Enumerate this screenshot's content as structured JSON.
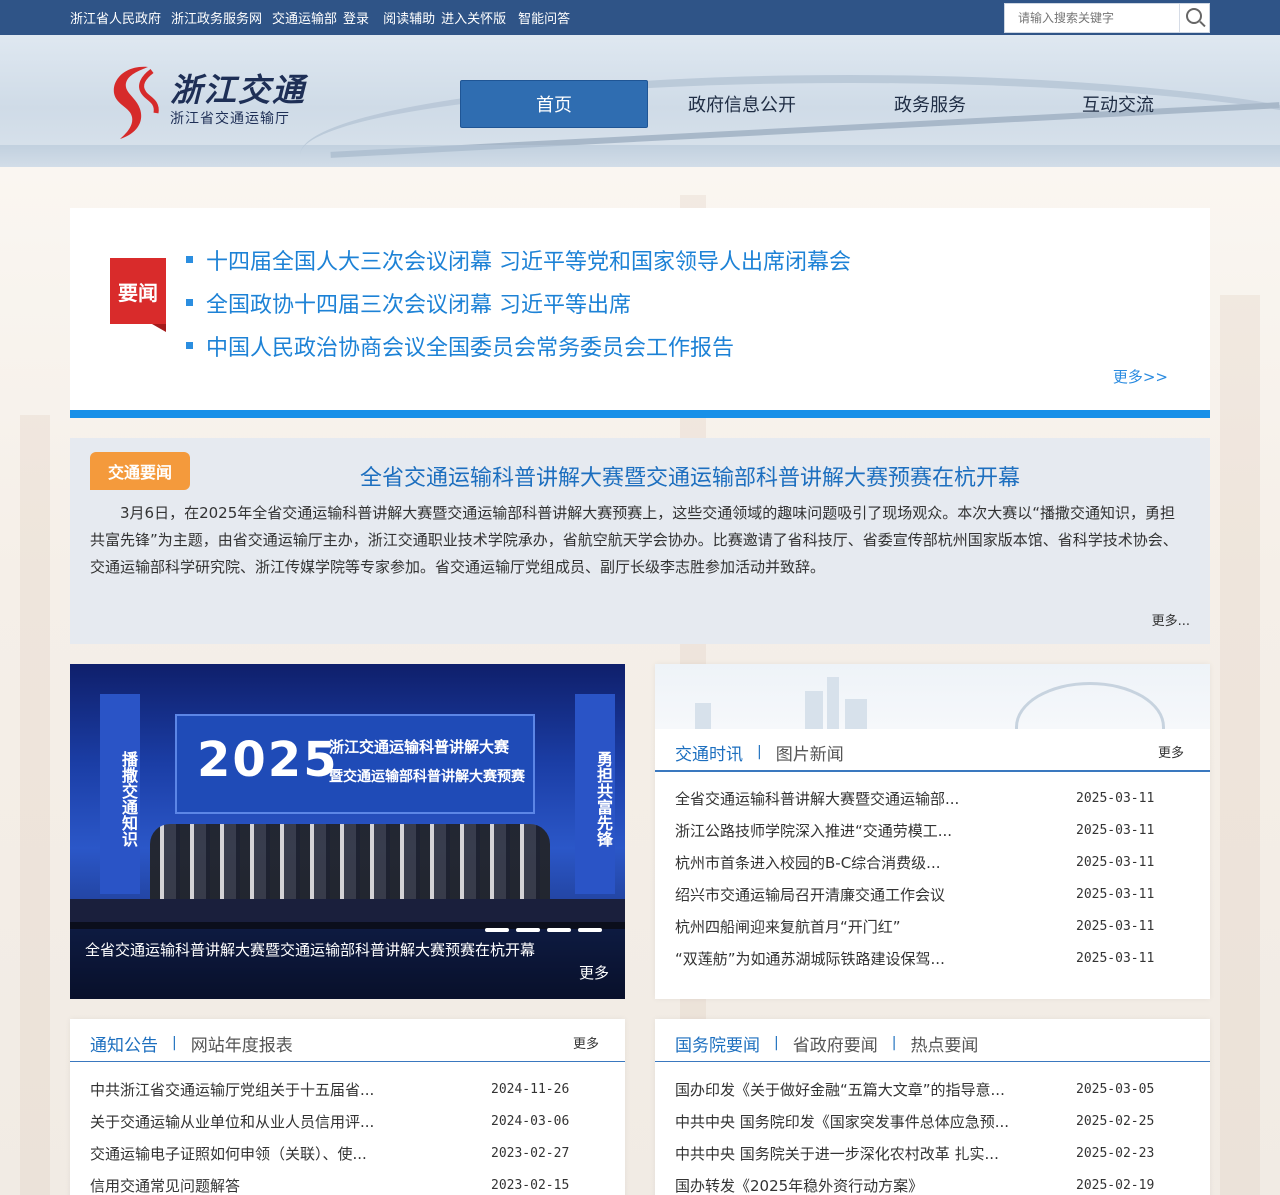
{
  "topbar": {
    "links": [
      "浙江省人民政府",
      "浙江政务服务网",
      "交通运输部",
      "登录",
      "阅读辅助",
      "进入关怀版",
      "智能问答"
    ],
    "search_placeholder": "请输入搜索关键字"
  },
  "header": {
    "logo_text": "浙江交通",
    "logo_sub": "浙江省交通运输厅",
    "nav": [
      "首页",
      "政府信息公开",
      "政务服务",
      "互动交流"
    ],
    "nav_active": 0
  },
  "headline": {
    "badge": "要闻",
    "items": [
      "十四届全国人大三次会议闭幕 习近平等党和国家领导人出席闭幕会",
      "全国政协十四届三次会议闭幕 习近平等出席",
      "中国人民政治协商会议全国委员会常务委员会工作报告"
    ],
    "more": "更多>>"
  },
  "traffic_news": {
    "tag": "交通要闻",
    "title": "全省交通运输科普讲解大赛暨交通运输部科普讲解大赛预赛在杭开幕",
    "body": "3月6日，在2025年全省交通运输科普讲解大赛暨交通运输部科普讲解大赛预赛上，这些交通领域的趣味问题吸引了现场观众。本次大赛以“播撒交通知识，勇担共富先锋”为主题，由省交通运输厅主办，浙江交通职业技术学院承办，省航空航天学会协办。比赛邀请了省科技厅、省委宣传部杭州国家版本馆、省科学技术协会、交通运输部科学研究院、浙江传媒学院等专家参加。省交通运输厅党组成员、副厅长级李志胜参加活动并致辞。",
    "more": "更多..."
  },
  "photo": {
    "screen_year": "2025",
    "screen_line1": "浙江交通运输科普讲解大赛",
    "screen_line2": "暨交通运输部科普讲解大赛预赛",
    "banner_left": "播撒交通知识",
    "banner_right": "勇担共富先锋",
    "caption": "全省交通运输科普讲解大赛暨交通运输部科普讲解大赛预赛在杭开幕",
    "more": "更多"
  },
  "news_card": {
    "tabs": [
      "交通时讯",
      "图片新闻"
    ],
    "more": "更多",
    "items": [
      {
        "title": "全省交通运输科普讲解大赛暨交通运输部...",
        "date": "2025-03-11"
      },
      {
        "title": "浙江公路技师学院深入推进“交通劳模工...",
        "date": "2025-03-11"
      },
      {
        "title": "杭州市首条进入校园的B-C综合消费级...",
        "date": "2025-03-11"
      },
      {
        "title": "绍兴市交通运输局召开清廉交通工作会议",
        "date": "2025-03-11"
      },
      {
        "title": "杭州四船闸迎来复航首月“开门红”",
        "date": "2025-03-11"
      },
      {
        "title": "“双莲舫”为如通苏湖城际铁路建设保驾...",
        "date": "2025-03-11"
      }
    ]
  },
  "notice_card": {
    "tabs": [
      "通知公告",
      "网站年度报表"
    ],
    "more": "更多",
    "items": [
      {
        "title": "中共浙江省交通运输厅党组关于十五届省...",
        "date": "2024-11-26"
      },
      {
        "title": "关于交通运输从业单位和从业人员信用评...",
        "date": "2024-03-06"
      },
      {
        "title": "交通运输电子证照如何申领（关联）、使...",
        "date": "2023-02-27"
      },
      {
        "title": "信用交通常见问题解答",
        "date": "2023-02-15"
      }
    ]
  },
  "gov_card": {
    "tabs": [
      "国务院要闻",
      "省政府要闻",
      "热点要闻"
    ],
    "items": [
      {
        "title": "国办印发《关于做好金融“五篇大文章”的指导意...",
        "date": "2025-03-05"
      },
      {
        "title": "中共中央 国务院印发《国家突发事件总体应急预...",
        "date": "2025-02-25"
      },
      {
        "title": "中共中央 国务院关于进一步深化农村改革 扎实...",
        "date": "2025-02-23"
      },
      {
        "title": "国办转发《2025年稳外资行动方案》",
        "date": "2025-02-19"
      }
    ]
  }
}
